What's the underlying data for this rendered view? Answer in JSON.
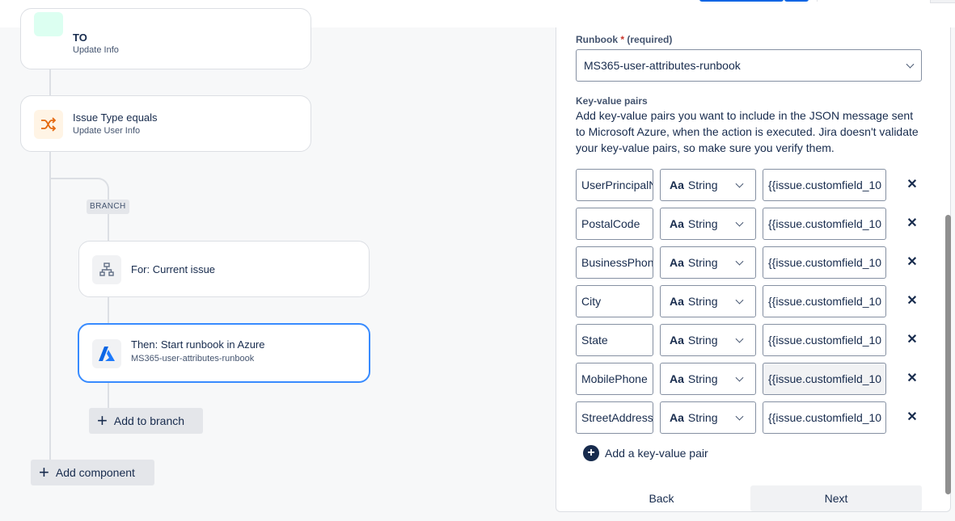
{
  "canvas": {
    "card_top": {
      "title": "TO",
      "subtitle": "Update Info"
    },
    "card_condition": {
      "title": "Issue Type equals",
      "subtitle": "Update User Info"
    },
    "branch_tag": "BRANCH",
    "card_for": {
      "title": "For: Current issue"
    },
    "card_action": {
      "title": "Then: Start runbook in Azure",
      "subtitle": "MS365-user-attributes-runbook"
    },
    "add_to_branch": "Add to branch",
    "add_component": "Add component"
  },
  "panel": {
    "runbook_label": "Runbook",
    "runbook_required": "(required)",
    "runbook_value": "MS365-user-attributes-runbook",
    "kv_label": "Key-value pairs",
    "kv_description": "Add key-value pairs you want to include in the JSON message sent to Microsoft Azure, when the action is executed. Jira doesn't validate your key-value pairs, so make sure you verify them.",
    "type_glyph": "Aa",
    "pairs": [
      {
        "key": "UserPrincipalName",
        "type": "String",
        "value": "{{issue.customfield_10"
      },
      {
        "key": "PostalCode",
        "type": "String",
        "value": "{{issue.customfield_10"
      },
      {
        "key": "BusinessPhone",
        "type": "String",
        "value": "{{issue.customfield_10"
      },
      {
        "key": "City",
        "type": "String",
        "value": "{{issue.customfield_10"
      },
      {
        "key": "State",
        "type": "String",
        "value": "{{issue.customfield_10"
      },
      {
        "key": "MobilePhone",
        "type": "String",
        "value": "{{issue.customfield_10"
      },
      {
        "key": "StreetAddress",
        "type": "String",
        "value": "{{issue.customfield_10"
      }
    ],
    "add_pair": "Add a key-value pair",
    "back": "Back",
    "next": "Next"
  },
  "colors": {
    "accent": "#0c66e4",
    "condition_icon_bg": "#fff4e5",
    "condition_icon": "#e56910"
  }
}
